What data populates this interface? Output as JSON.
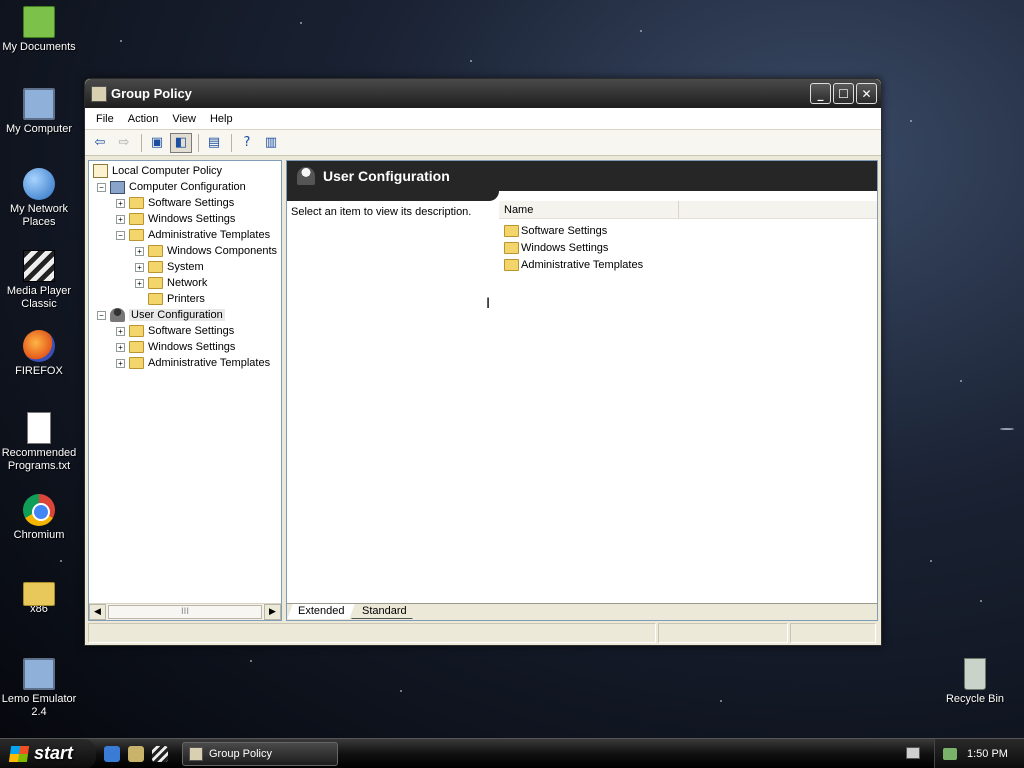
{
  "desktop": {
    "icons": [
      {
        "label": "My Documents"
      },
      {
        "label": "My Computer"
      },
      {
        "label": "My Network Places"
      },
      {
        "label": "Media Player Classic"
      },
      {
        "label": "FIREFOX"
      },
      {
        "label": "Recommended Programs.txt"
      },
      {
        "label": "Chromium"
      },
      {
        "label": "x86"
      },
      {
        "label": "Lemo Emulator 2.4"
      },
      {
        "label": "Recycle Bin"
      }
    ]
  },
  "window": {
    "title": "Group Policy",
    "menu": [
      "File",
      "Action",
      "View",
      "Help"
    ],
    "toolbar_icons": [
      "back-arrow-icon",
      "forward-arrow-icon",
      "up-folder-icon",
      "show-hide-tree-icon",
      "export-list-icon",
      "help-icon",
      "properties-icon"
    ]
  },
  "tree": {
    "root": "Local Computer Policy",
    "items": [
      {
        "label": "Computer Configuration"
      },
      {
        "label": "Software Settings"
      },
      {
        "label": "Windows Settings"
      },
      {
        "label": "Administrative Templates"
      },
      {
        "label": "Windows Components"
      },
      {
        "label": "System"
      },
      {
        "label": "Network"
      },
      {
        "label": "Printers"
      },
      {
        "label": "User Configuration"
      },
      {
        "label": "Software Settings"
      },
      {
        "label": "Windows Settings"
      },
      {
        "label": "Administrative Templates"
      }
    ],
    "scroll_grip": "III"
  },
  "details": {
    "header": "User Configuration",
    "description": "Select an item to view its description.",
    "column_name": "Name",
    "items": [
      "Software Settings",
      "Windows Settings",
      "Administrative Templates"
    ],
    "tabs": [
      "Extended",
      "Standard"
    ]
  },
  "taskbar": {
    "start_label": "start",
    "task_title": "Group Policy",
    "clock": "1:50 PM"
  }
}
